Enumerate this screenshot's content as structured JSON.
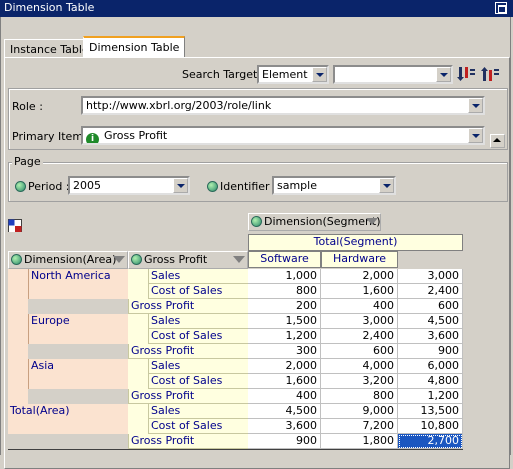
{
  "window": {
    "title": "Dimension Table"
  },
  "tabs": [
    {
      "label": "Instance Table"
    },
    {
      "label": "Dimension Table"
    }
  ],
  "search": {
    "label": "Search Target",
    "target_value": "Element",
    "query_value": ""
  },
  "role": {
    "label": "Role :",
    "value": "http://www.xbrl.org/2003/role/link"
  },
  "primary_item": {
    "label": "Primary Item :",
    "value": "Gross Profit"
  },
  "page": {
    "group_label": "Page",
    "period_label": "Period :",
    "period_value": "2005",
    "identifier_label": "Identifier :",
    "identifier_value": "sample"
  },
  "table": {
    "column_dimension": "Dimension(Segment)",
    "column_total": "Total(Segment)",
    "columns": [
      "Software",
      "Hardware"
    ],
    "row_dimension": "Dimension(Area)",
    "row_item_header": "Gross Profit",
    "groups": [
      {
        "area": "North America",
        "rows": [
          {
            "item": "Sales",
            "values": [
              "1,000",
              "2,000",
              "3,000"
            ]
          },
          {
            "item": "Cost of Sales",
            "values": [
              "800",
              "1,600",
              "2,400"
            ]
          },
          {
            "item": "Gross Profit",
            "values": [
              "200",
              "400",
              "600"
            ]
          }
        ]
      },
      {
        "area": "Europe",
        "rows": [
          {
            "item": "Sales",
            "values": [
              "1,500",
              "3,000",
              "4,500"
            ]
          },
          {
            "item": "Cost of Sales",
            "values": [
              "1,200",
              "2,400",
              "3,600"
            ]
          },
          {
            "item": "Gross Profit",
            "values": [
              "300",
              "600",
              "900"
            ]
          }
        ]
      },
      {
        "area": "Asia",
        "rows": [
          {
            "item": "Sales",
            "values": [
              "2,000",
              "4,000",
              "6,000"
            ]
          },
          {
            "item": "Cost of Sales",
            "values": [
              "1,600",
              "3,200",
              "4,800"
            ]
          },
          {
            "item": "Gross Profit",
            "values": [
              "400",
              "800",
              "1,200"
            ]
          }
        ]
      },
      {
        "area": "Total(Area)",
        "rows": [
          {
            "item": "Sales",
            "values": [
              "4,500",
              "9,000",
              "13,500"
            ]
          },
          {
            "item": "Cost of Sales",
            "values": [
              "3,600",
              "7,200",
              "10,800"
            ]
          },
          {
            "item": "Gross Profit",
            "values": [
              "900",
              "1,800",
              "2,700"
            ]
          }
        ]
      }
    ],
    "selected_cell": "2,700"
  },
  "colors": {
    "titlebar": "#0a246a",
    "area_bg": "#fbe3d0",
    "item_bg": "#ffffe0",
    "selected": "#1a56c0",
    "tab_accent": "#f0a020"
  },
  "icons": {
    "search_next": "sort-down-icon",
    "search_prev": "sort-up-icon",
    "corner": "table-corner-icon"
  }
}
